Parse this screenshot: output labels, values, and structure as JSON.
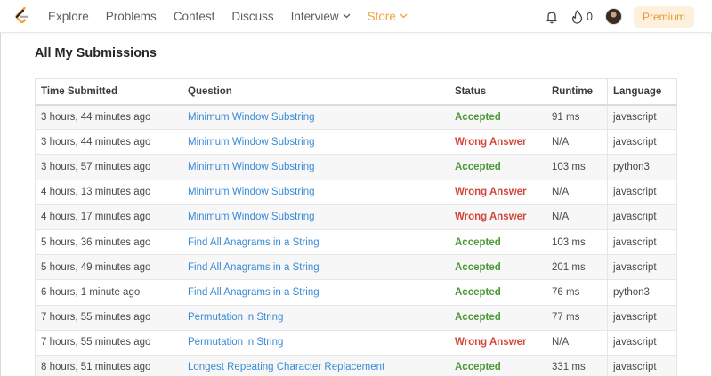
{
  "nav": {
    "items": [
      {
        "label": "Explore"
      },
      {
        "label": "Problems"
      },
      {
        "label": "Contest"
      },
      {
        "label": "Discuss"
      },
      {
        "label": "Interview"
      },
      {
        "label": "Store"
      }
    ],
    "streak_count": "0",
    "premium_label": "Premium"
  },
  "page": {
    "title": "All My Submissions"
  },
  "table": {
    "headers": [
      "Time Submitted",
      "Question",
      "Status",
      "Runtime",
      "Language"
    ],
    "rows": [
      {
        "time": "3 hours, 44 minutes ago",
        "question": "Minimum Window Substring",
        "status": "Accepted",
        "runtime": "91 ms",
        "language": "javascript"
      },
      {
        "time": "3 hours, 44 minutes ago",
        "question": "Minimum Window Substring",
        "status": "Wrong Answer",
        "runtime": "N/A",
        "language": "javascript"
      },
      {
        "time": "3 hours, 57 minutes ago",
        "question": "Minimum Window Substring",
        "status": "Accepted",
        "runtime": "103 ms",
        "language": "python3"
      },
      {
        "time": "4 hours, 13 minutes ago",
        "question": "Minimum Window Substring",
        "status": "Wrong Answer",
        "runtime": "N/A",
        "language": "javascript"
      },
      {
        "time": "4 hours, 17 minutes ago",
        "question": "Minimum Window Substring",
        "status": "Wrong Answer",
        "runtime": "N/A",
        "language": "javascript"
      },
      {
        "time": "5 hours, 36 minutes ago",
        "question": "Find All Anagrams in a String",
        "status": "Accepted",
        "runtime": "103 ms",
        "language": "javascript"
      },
      {
        "time": "5 hours, 49 minutes ago",
        "question": "Find All Anagrams in a String",
        "status": "Accepted",
        "runtime": "201 ms",
        "language": "javascript"
      },
      {
        "time": "6 hours, 1 minute ago",
        "question": "Find All Anagrams in a String",
        "status": "Accepted",
        "runtime": "76 ms",
        "language": "python3"
      },
      {
        "time": "7 hours, 55 minutes ago",
        "question": "Permutation in String",
        "status": "Accepted",
        "runtime": "77 ms",
        "language": "javascript"
      },
      {
        "time": "7 hours, 55 minutes ago",
        "question": "Permutation in String",
        "status": "Wrong Answer",
        "runtime": "N/A",
        "language": "javascript"
      },
      {
        "time": "8 hours, 51 minutes ago",
        "question": "Longest Repeating Character Replacement",
        "status": "Accepted",
        "runtime": "331 ms",
        "language": "javascript"
      }
    ]
  },
  "colors": {
    "accepted": "#4d9a3a",
    "wrong_answer": "#d0473b",
    "link": "#3a8bd6",
    "store": "#f0a339",
    "premium_bg": "#fdf0dd"
  },
  "icons": {
    "logo": "leetcode-logo-icon",
    "bell": "bell-icon",
    "flame": "flame-icon",
    "chevron": "chevron-down-icon"
  }
}
